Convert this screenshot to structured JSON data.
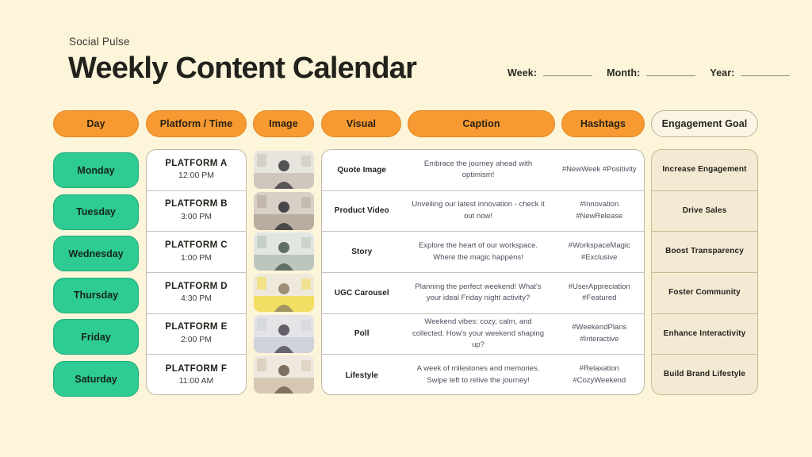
{
  "header": {
    "brand": "Social Pulse",
    "title": "Weekly Content Calendar",
    "meta": {
      "week_label": "Week:",
      "month_label": "Month:",
      "year_label": "Year:",
      "week_value": "",
      "month_value": "",
      "year_value": ""
    }
  },
  "colors": {
    "background": "#fcf5da",
    "accent_orange": "#f79a31",
    "accent_green": "#2ecb92",
    "goal_beige": "#f4ead4",
    "text_dark": "#22211c",
    "text_muted": "#49505c"
  },
  "columns": [
    {
      "id": "day",
      "label": "Day",
      "style": "filled"
    },
    {
      "id": "platform",
      "label": "Platform / Time",
      "style": "filled"
    },
    {
      "id": "image",
      "label": "Image",
      "style": "filled"
    },
    {
      "id": "visual",
      "label": "Visual",
      "style": "filled"
    },
    {
      "id": "caption",
      "label": "Caption",
      "style": "filled"
    },
    {
      "id": "hashtags",
      "label": "Hashtags",
      "style": "filled"
    },
    {
      "id": "goal",
      "label": "Engagement Goal",
      "style": "outline"
    }
  ],
  "rows": [
    {
      "day": "Monday",
      "platform": "PLATFORM A",
      "time": "12:00 PM",
      "image_alt": "person stretching arms behind head",
      "visual": "Quote Image",
      "caption": "Embrace the journey ahead with optimism!",
      "hashtags": "#NewWeek #Positivity",
      "goal": "Increase Engagement"
    },
    {
      "day": "Tuesday",
      "platform": "PLATFORM B",
      "time": "3:00 PM",
      "image_alt": "team meeting around a table",
      "visual": "Product Video",
      "caption": "Unveiling our latest innovation - check it out now!",
      "hashtags": "#Innovation #NewRelease",
      "goal": "Drive Sales"
    },
    {
      "day": "Wednesday",
      "platform": "PLATFORM C",
      "time": "1:00 PM",
      "image_alt": "colleagues working in bright office",
      "visual": "Story",
      "caption": "Explore the heart of our workspace. Where the magic happens!",
      "hashtags": "#WorkspaceMagic #Exclusive",
      "goal": "Boost Transparency"
    },
    {
      "day": "Thursday",
      "platform": "PLATFORM D",
      "time": "4:30 PM",
      "image_alt": "hand writing on sticky notes",
      "visual": "UGC Carousel",
      "caption": "Planning the perfect weekend! What's your ideal Friday night activity?",
      "hashtags": "#UserAppreciation #Featured",
      "goal": "Foster Community"
    },
    {
      "day": "Friday",
      "platform": "PLATFORM E",
      "time": "2:00 PM",
      "image_alt": "person holding phone near flowers",
      "visual": "Poll",
      "caption": "Weekend vibes: cozy, calm, and collected. How's your weekend shaping up?",
      "hashtags": "#WeekendPlans #Interactive",
      "goal": "Enhance Interactivity"
    },
    {
      "day": "Saturday",
      "platform": "PLATFORM F",
      "time": "11:00 AM",
      "image_alt": "person relaxing in rattan chair",
      "visual": "Lifestyle",
      "caption": "A week of milestones and memories. Swipe left to relive the journey!",
      "hashtags": "#Relaxation #CozyWeekend",
      "goal": "Build Brand Lifestyle"
    }
  ]
}
